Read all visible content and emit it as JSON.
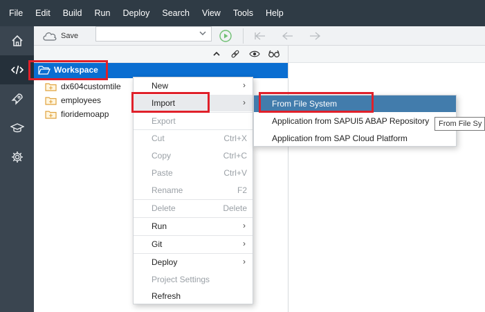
{
  "menubar": {
    "items": [
      "File",
      "Edit",
      "Build",
      "Run",
      "Deploy",
      "Search",
      "View",
      "Tools",
      "Help"
    ]
  },
  "sidenav": {
    "items": [
      {
        "icon": "home-icon"
      },
      {
        "icon": "code-icon",
        "active": true
      },
      {
        "icon": "rocket-icon"
      },
      {
        "icon": "graduation-cap-icon"
      },
      {
        "icon": "gear-icon"
      }
    ]
  },
  "toolbar": {
    "save_label": "Save",
    "combo_value": ""
  },
  "workspace": {
    "root_label": "Workspace",
    "items": [
      "dx604customtile",
      "employees",
      "fioridemoapp"
    ]
  },
  "context_menu": {
    "items": [
      {
        "label": "New",
        "submenu": true
      },
      {
        "label": "Import",
        "submenu": true,
        "highlighted": true
      },
      {
        "label": "Export",
        "disabled": true
      },
      {
        "label": "Cut",
        "shortcut": "Ctrl+X",
        "disabled": true
      },
      {
        "label": "Copy",
        "shortcut": "Ctrl+C",
        "disabled": true
      },
      {
        "label": "Paste",
        "shortcut": "Ctrl+V",
        "disabled": true
      },
      {
        "label": "Rename",
        "shortcut": "F2",
        "disabled": true
      },
      {
        "label": "Delete",
        "shortcut": "Delete",
        "disabled": true
      },
      {
        "label": "Run",
        "submenu": true
      },
      {
        "label": "Git",
        "submenu": true
      },
      {
        "label": "Deploy",
        "submenu": true
      },
      {
        "label": "Project Settings",
        "disabled": true
      },
      {
        "label": "Refresh"
      }
    ]
  },
  "import_submenu": {
    "items": [
      "From File System",
      "Application from SAPUI5 ABAP Repository",
      "Application from SAP Cloud Platform"
    ]
  },
  "tooltip": {
    "text": "From File Sy"
  },
  "colors": {
    "menubar_bg": "#2f3b45",
    "sidenav_bg": "#3a4550",
    "selection_blue": "#0a6ed1",
    "submenu_selected": "#427cac",
    "highlight_box": "#e0202a"
  }
}
